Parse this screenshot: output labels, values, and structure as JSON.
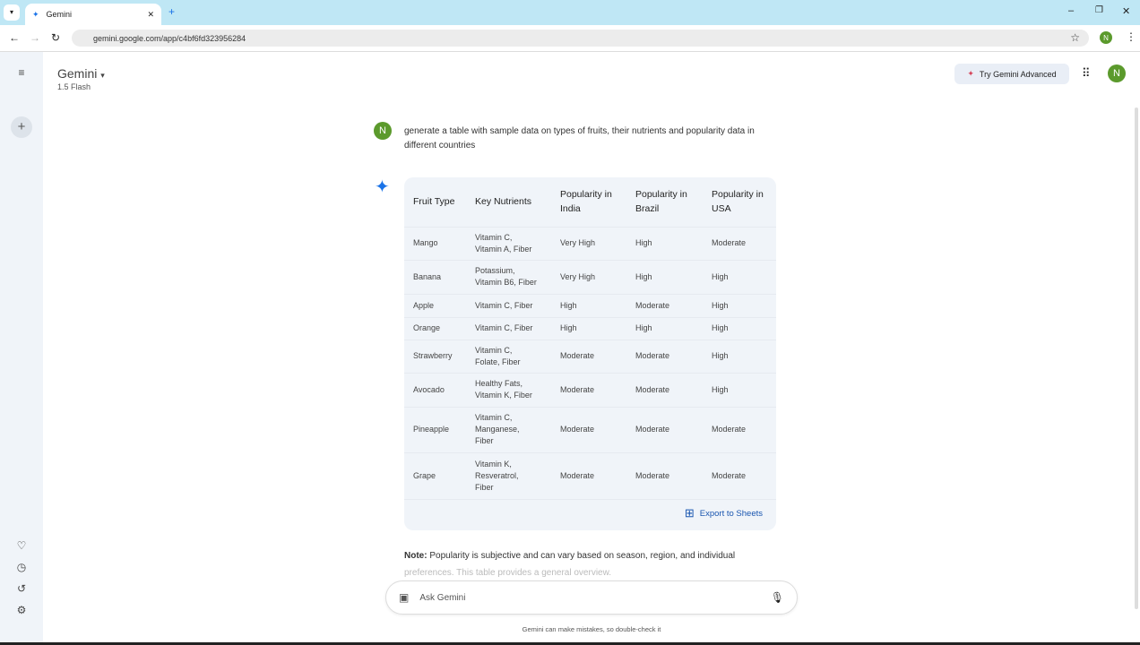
{
  "browser": {
    "tab_title": "Gemini",
    "url": "gemini.google.com/app/c4bf6fd323956284",
    "profile_initial": "N"
  },
  "header": {
    "app_name": "Gemini",
    "model": "1.5 Flash",
    "try_advanced": "Try Gemini Advanced",
    "user_initial": "N"
  },
  "chat": {
    "user_initial": "N",
    "prompt": "generate a table with sample data on types of fruits, their nutrients and popularity data in different countries"
  },
  "table": {
    "headers": [
      "Fruit Type",
      "Key Nutrients",
      "Popularity in India",
      "Popularity in Brazil",
      "Popularity in USA"
    ],
    "rows": [
      [
        "Mango",
        "Vitamin C, Vitamin A, Fiber",
        "Very High",
        "High",
        "Moderate"
      ],
      [
        "Banana",
        "Potassium, Vitamin B6, Fiber",
        "Very High",
        "High",
        "High"
      ],
      [
        "Apple",
        "Vitamin C, Fiber",
        "High",
        "Moderate",
        "High"
      ],
      [
        "Orange",
        "Vitamin C, Fiber",
        "High",
        "High",
        "High"
      ],
      [
        "Strawberry",
        "Vitamin C, Folate, Fiber",
        "Moderate",
        "Moderate",
        "High"
      ],
      [
        "Avocado",
        "Healthy Fats, Vitamin K, Fiber",
        "Moderate",
        "Moderate",
        "High"
      ],
      [
        "Pineapple",
        "Vitamin C, Manganese, Fiber",
        "Moderate",
        "Moderate",
        "Moderate"
      ],
      [
        "Grape",
        "Vitamin K, Resveratrol, Fiber",
        "Moderate",
        "Moderate",
        "Moderate"
      ]
    ],
    "export_label": "Export to Sheets"
  },
  "note": {
    "label": "Note:",
    "text": " Popularity is subjective and can vary based on season, region, and individual",
    "faded": "preferences. This table provides a general overview."
  },
  "input": {
    "placeholder": "Ask Gemini"
  },
  "disclaimer": "Gemini can make mistakes, so double-check it",
  "colors": {
    "accent": "#1a73e8",
    "avatar": "#5b9a2c",
    "sidebar": "#f0f4f9"
  }
}
